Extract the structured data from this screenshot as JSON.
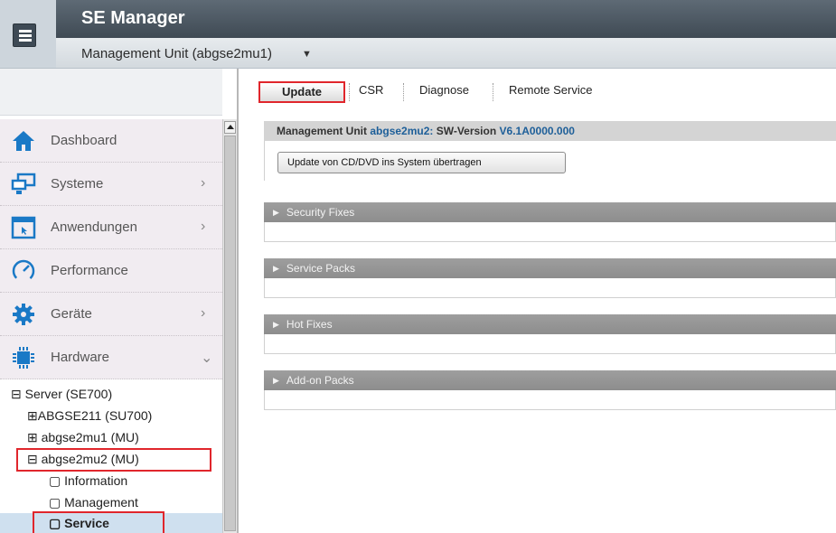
{
  "header": {
    "app_title": "SE Manager",
    "unit_selector": "Management Unit (abgse2mu1)",
    "caret": "▼"
  },
  "sidebar": {
    "nav_items": [
      {
        "label": "Dashboard",
        "icon": "home-icon",
        "arrow": ""
      },
      {
        "label": "Systeme",
        "icon": "monitor-icon",
        "arrow": "›"
      },
      {
        "label": "Anwendungen",
        "icon": "window-icon",
        "arrow": "›"
      },
      {
        "label": "Performance",
        "icon": "gauge-icon",
        "arrow": ""
      },
      {
        "label": "Geräte",
        "icon": "gear-icon",
        "arrow": "›"
      },
      {
        "label": "Hardware",
        "icon": "chip-icon",
        "arrow": "⌄"
      }
    ],
    "tree": {
      "server": "⊟ Server (SE700)",
      "su": "⊞ABGSE211 (SU700)",
      "mu1": "⊞ abgse2mu1 (MU)",
      "mu2": "⊟ abgse2mu2 (MU)",
      "information": "▢ Information",
      "management": "▢ Management",
      "service": "▢ Service"
    }
  },
  "tabs": {
    "update": "Update",
    "csr": "CSR",
    "diagnose": "Diagnose",
    "remote": "Remote Service"
  },
  "sw_version": {
    "prefix": "Management Unit",
    "unit": "abgse2mu2:",
    "label": "SW-Version",
    "version": "V6.1A0000.000",
    "button": "Update von CD/DVD ins System übertragen"
  },
  "sections": {
    "security": "Security Fixes",
    "service_packs": "Service Packs",
    "hot_fixes": "Hot Fixes",
    "addon": "Add-on Packs",
    "expand_glyph": "▶"
  },
  "colors": {
    "topbar": "#4b5661",
    "highlight": "#e0262c",
    "link_blue": "#1e5f99",
    "section_header": "#959595"
  }
}
